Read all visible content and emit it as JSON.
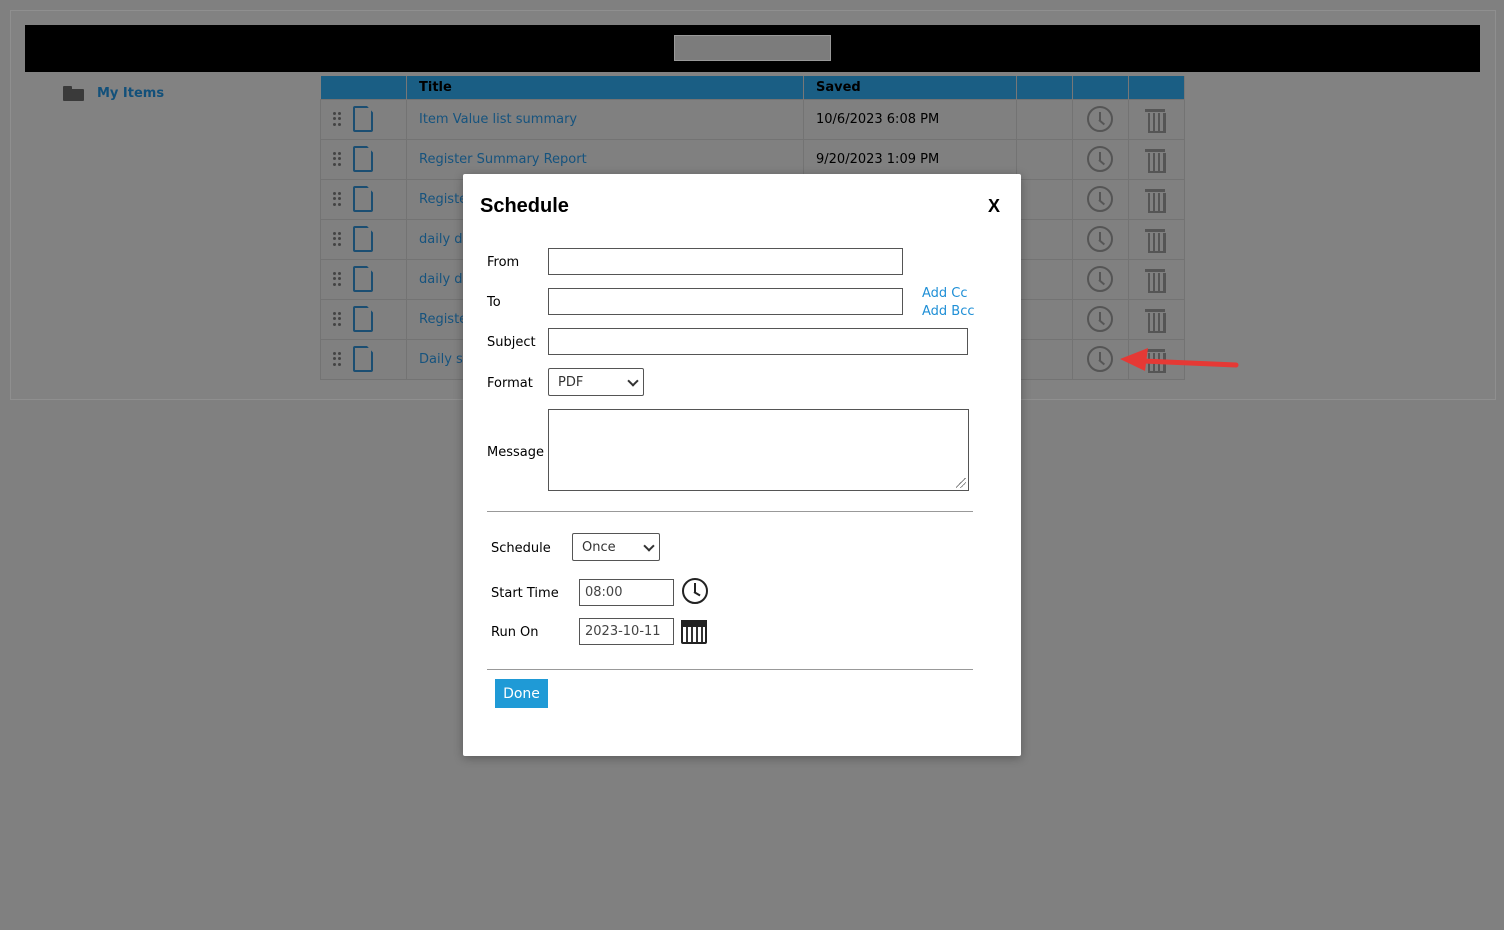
{
  "sidebar": {
    "items": [
      {
        "label": "My Items",
        "icon": "folder-icon"
      }
    ]
  },
  "table": {
    "headers": [
      "",
      "Title",
      "Saved",
      "",
      "",
      ""
    ],
    "rows": [
      {
        "title": "Item Value list summary",
        "saved": "10/6/2023 6:08 PM"
      },
      {
        "title": "Register Summary Report",
        "saved": "9/20/2023 1:09 PM"
      },
      {
        "title": "Registe",
        "saved": ""
      },
      {
        "title": "daily di",
        "saved": ""
      },
      {
        "title": "daily di",
        "saved": ""
      },
      {
        "title": "Registe",
        "saved": ""
      },
      {
        "title": "Daily sa",
        "saved": ""
      }
    ]
  },
  "modal": {
    "title": "Schedule",
    "close_label": "X",
    "from_label": "From",
    "from_value": "",
    "to_label": "To",
    "to_value": "",
    "add_cc": "Add Cc",
    "add_bcc": "Add Bcc",
    "subject_label": "Subject",
    "subject_value": "",
    "format_label": "Format",
    "format_value": "PDF",
    "message_label": "Message",
    "schedule_label": "Schedule",
    "schedule_value": "Once",
    "start_time_label": "Start Time",
    "start_time_value": "08:00",
    "run_on_label": "Run On",
    "run_on_value": "2023-10-11",
    "done_label": "Done"
  },
  "colors": {
    "accent": "#1f9ad6",
    "annotation_arrow": "#e53935",
    "header_bg": "#1a5e84"
  }
}
